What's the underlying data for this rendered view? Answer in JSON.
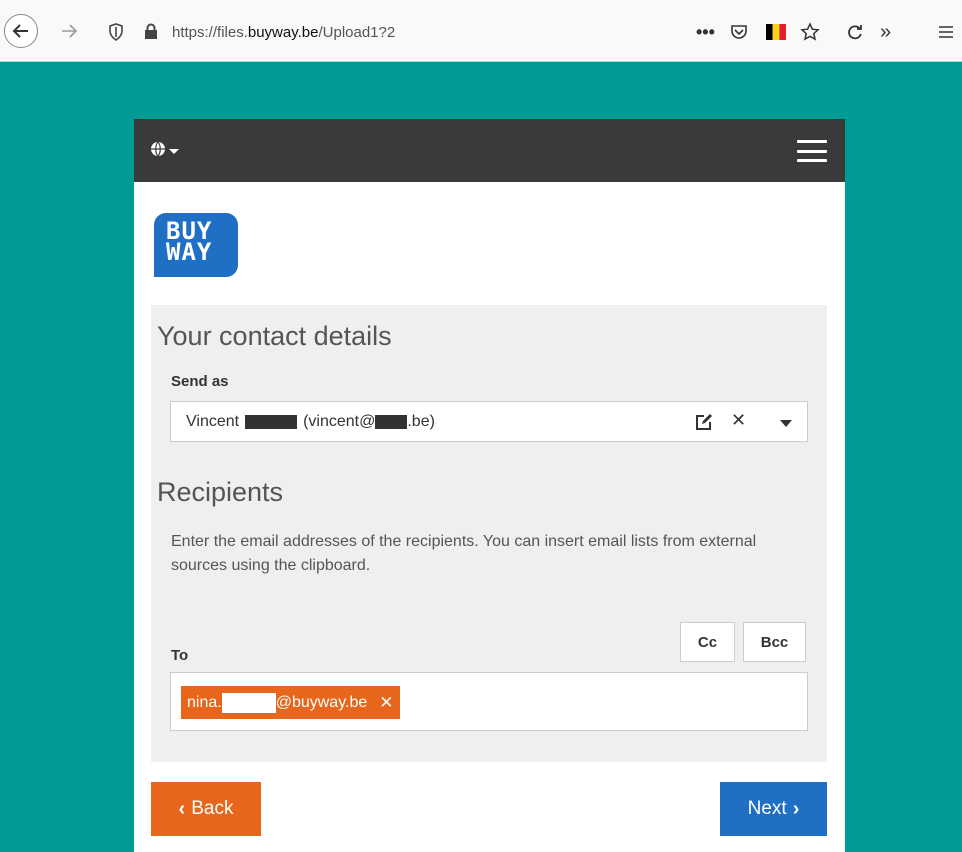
{
  "browser": {
    "url_prefix": "https://files.",
    "url_domain": "buyway.be",
    "url_path": "/Upload1?2",
    "icons": [
      "back-icon",
      "forward-icon",
      "shield-icon",
      "lock-icon",
      "more-icon",
      "pocket-icon",
      "flag-icon",
      "star-icon",
      "reload-icon",
      "overflow-icon",
      "menu-icon"
    ]
  },
  "logo": {
    "line1": "BUY",
    "line2": "WAY",
    "color": "#1f6fc5"
  },
  "contact": {
    "heading": "Your contact details",
    "send_as_label": "Send as",
    "sender_first": "Vincent",
    "sender_email_prefix": "(vincent@",
    "sender_email_suffix": ".be)"
  },
  "recipients": {
    "heading": "Recipients",
    "description": "Enter the email addresses of the recipients. You can insert email lists from external sources using the clipboard.",
    "cc_label": "Cc",
    "bcc_label": "Bcc",
    "to_label": "To",
    "chip_prefix": "nina.",
    "chip_suffix": "@buyway.be"
  },
  "actions": {
    "back_label": "Back",
    "next_label": "Next"
  },
  "colors": {
    "background": "#009b95",
    "nav": "#3a3a3a",
    "accent_orange": "#e8661b",
    "accent_blue": "#1f6fc5"
  }
}
